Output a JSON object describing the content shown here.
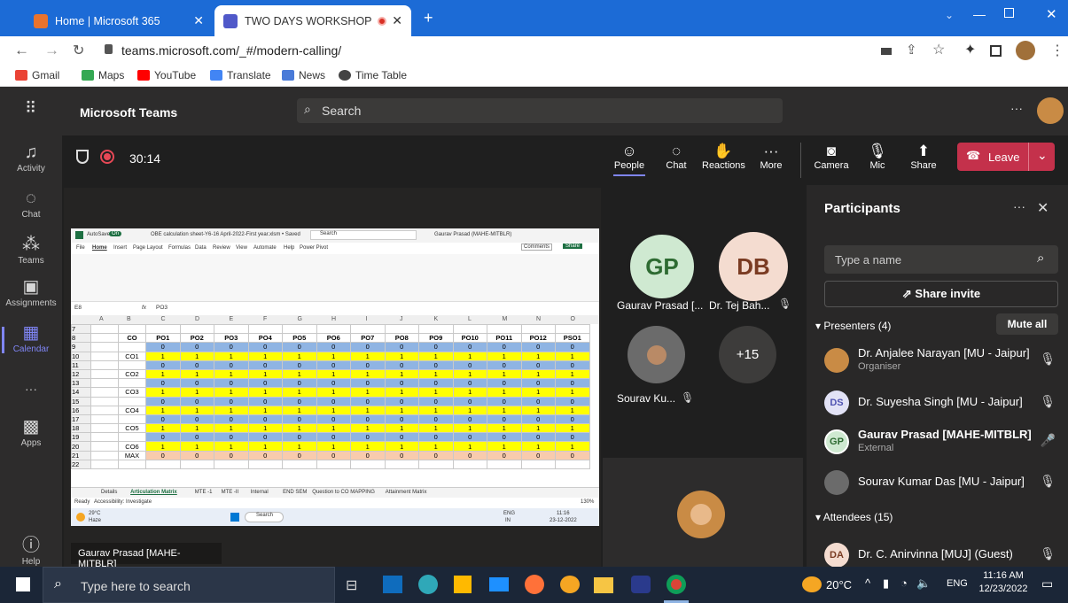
{
  "browser": {
    "tabs": [
      {
        "title": "Home | Microsoft 365",
        "active": false
      },
      {
        "title": "TWO DAYS WORKSHOP ON",
        "active": true
      }
    ],
    "url": "teams.microsoft.com/_#/modern-calling/",
    "bookmarks": [
      "Gmail",
      "Maps",
      "YouTube",
      "Translate",
      "News",
      "Time Table"
    ]
  },
  "teams": {
    "app_name": "Microsoft Teams",
    "search_placeholder": "Search",
    "rail": [
      "Activity",
      "Chat",
      "Teams",
      "Assignments",
      "Calendar",
      "Apps",
      "Help"
    ],
    "meeting_timer": "30:14",
    "controls": [
      "People",
      "Chat",
      "Reactions",
      "More",
      "Camera",
      "Mic",
      "Share"
    ],
    "leave_label": "Leave"
  },
  "stage": {
    "presenter_label": "Gaurav Prasad [MAHE-MITBLR]",
    "tiles": [
      {
        "initials": "GP",
        "name": "Gaurav Prasad [..."
      },
      {
        "initials": "DB",
        "name": "Dr. Tej Bah..."
      },
      {
        "initials": "",
        "name": "Sourav Ku..."
      },
      {
        "initials": "+15",
        "name": ""
      }
    ]
  },
  "sheet": {
    "autosave": "AutoSave",
    "autosave_state": "On",
    "filename": "OBE calculation sheet-Y6-16 April-2022-First year.xlsm • Saved",
    "search": "Search",
    "user": "Gaurav Prasad (MAHE-MITBLR)",
    "menu": [
      "File",
      "Home",
      "Insert",
      "Page Layout",
      "Formulas",
      "Data",
      "Review",
      "View",
      "Automate",
      "Help",
      "Power Pivot"
    ],
    "comments": "Comments",
    "share": "Share",
    "cell_ref": "E8",
    "formula": "PO3",
    "col_letters": [
      "A",
      "B",
      "C",
      "D",
      "E",
      "F",
      "G",
      "H",
      "I",
      "J",
      "K",
      "L",
      "M",
      "N",
      "O"
    ],
    "headers": [
      "CO",
      "PO1",
      "PO2",
      "PO3",
      "PO4",
      "PO5",
      "PO6",
      "PO7",
      "PO8",
      "PO9",
      "PO10",
      "PO11",
      "PO12",
      "PSO1"
    ],
    "row_labels": [
      "CO1",
      "CO2",
      "CO3",
      "CO4",
      "CO5",
      "CO6",
      "MAX"
    ],
    "sheet_tabs": [
      "Details",
      "Articulation Matrix",
      "MTE -1",
      "MTE -II",
      "Internal",
      "END SEM",
      "Question to CO MAPPING",
      "Attainment Matrix"
    ],
    "status_left": "Ready",
    "accessibility": "Accessibility: Investigate",
    "zoom": "130%",
    "weather_temp": "29°C",
    "weather_desc": "Haze",
    "inner_search": "Search",
    "inner_lang": "ENG",
    "inner_lang_sub": "IN",
    "inner_time": "11:16",
    "inner_date": "23-12-2022"
  },
  "participants": {
    "title": "Participants",
    "search_placeholder": "Type a name",
    "share_invite": "Share invite",
    "presenters_label": "Presenters (4)",
    "mute_all": "Mute all",
    "presenters": [
      {
        "initials": "",
        "name": "Dr. Anjalee Narayan [MU - Jaipur]",
        "sub": "Organiser"
      },
      {
        "initials": "DS",
        "name": "Dr. Suyesha Singh [MU - Jaipur]",
        "sub": ""
      },
      {
        "initials": "GP",
        "name": "Gaurav Prasad [MAHE-MITBLR]",
        "sub": "External"
      },
      {
        "initials": "",
        "name": "Sourav Kumar Das [MU - Jaipur]",
        "sub": ""
      }
    ],
    "attendees_label": "Attendees (15)",
    "attendees": [
      {
        "initials": "DA",
        "name": "Dr. C. Anirvinna [MUJ] (Guest)"
      }
    ]
  },
  "taskbar": {
    "search_placeholder": "Type here to search",
    "temp": "20°C",
    "lang": "ENG",
    "time": "11:16 AM",
    "date": "12/23/2022"
  }
}
